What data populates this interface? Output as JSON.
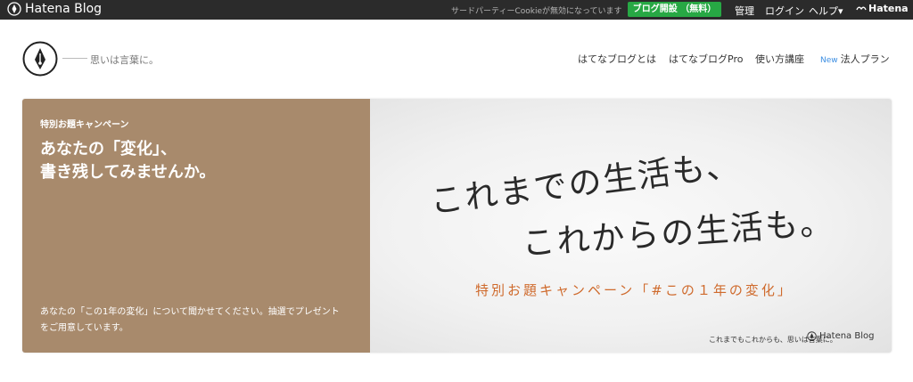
{
  "topbar": {
    "brand": "Hatena Blog",
    "cookie_note": "サードパーティーCookieが無効になっています",
    "signup": "ブログ開設 （無料）",
    "manage": "管理",
    "login": "ログイン",
    "help": "ヘルプ▾",
    "hatena": "Hatena"
  },
  "header": {
    "tagline": "思いは言葉に。",
    "nav": [
      {
        "label": "はてなブログとは"
      },
      {
        "label": "はてなブログPro"
      },
      {
        "label": "使い方講座"
      },
      {
        "badge": "New",
        "label": "法人プラン"
      }
    ]
  },
  "hero": {
    "campaign_label": "特別お題キャンペーン",
    "title_line1": "あなたの「変化」、",
    "title_line2": "書き残してみませんか。",
    "description": "あなたの「この1年の変化」について聞かせてください。抽選でプレゼントをご用意しています。",
    "handwriting_line1": "これまでの生活も、",
    "handwriting_line2": "これからの生活も。",
    "campaign_subtitle": "特別お題キャンペーン「#この１年の変化」",
    "credit": "これまでもこれからも、思いは言葉に。",
    "credit_logo": "Hatena Blog"
  },
  "colors": {
    "topbar_bg": "#2b2b2b",
    "signup_green": "#27a844",
    "hero_brown": "#a88a6c",
    "campaign_orange": "#cf6a2c",
    "new_badge_blue": "#3c8ee2"
  }
}
